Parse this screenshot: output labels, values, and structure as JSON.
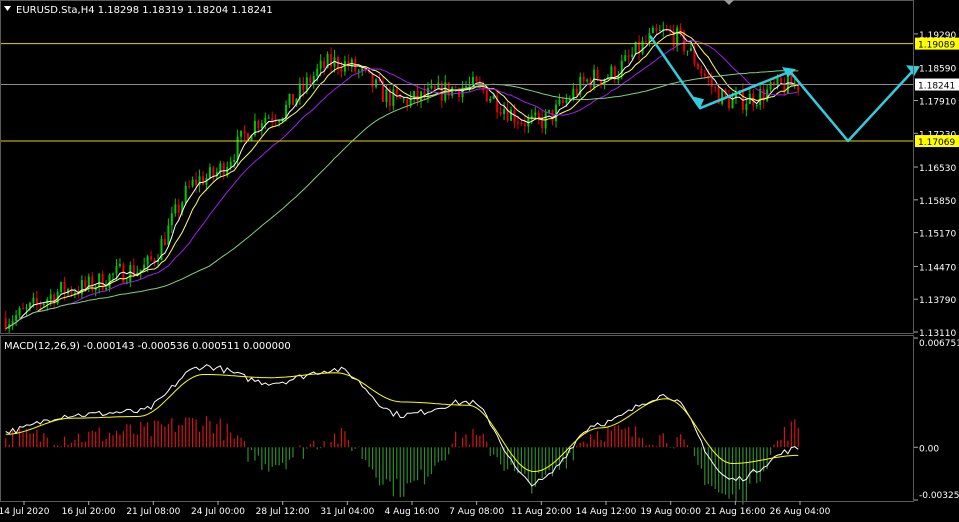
{
  "price_panel": {
    "header": "EURUSD.Sta,H4  1.18298 1.18319 1.18204 1.18241",
    "y_ticks": [
      "1.19290",
      "1.18590",
      "1.17910",
      "1.17230",
      "1.16530",
      "1.15850",
      "1.15170",
      "1.14470",
      "1.13790",
      "1.13110"
    ],
    "resistance_label": "1.19089",
    "current_label": "1.18241",
    "support_label": "1.17069"
  },
  "macd_panel": {
    "header": "MACD(12,26,9) -0.000143 -0.000536 0.000511 0.000000",
    "y_ticks": [
      "0.006751",
      "0.00",
      "-0.003256"
    ]
  },
  "x_ticks": [
    "14 Jul 2020",
    "16 Jul 20:00",
    "21 Jul 08:00",
    "24 Jul 00:00",
    "28 Jul 12:00",
    "31 Jul 04:00",
    "4 Aug 16:00",
    "7 Aug 08:00",
    "11 Aug 20:00",
    "14 Aug 12:00",
    "19 Aug 00:00",
    "21 Aug 16:00",
    "26 Aug 04:00"
  ],
  "colors": {
    "background": "#000000",
    "bull": "#00c800",
    "bear": "#e60000",
    "level_line": "#e6d200",
    "current_line": "#8c8c8c",
    "ma_white": "#ffffff",
    "ma_yellow": "#ffff66",
    "ma_purple": "#a020f0",
    "ma_green": "#7fd07f",
    "forecast": "#33ccdd",
    "macd_line": "#ffffff",
    "signal_line": "#ffff00",
    "hist_up": "#d21414",
    "hist_down": "#2e8b2e",
    "label_bg": "#ffff00",
    "text": "#ffffff"
  },
  "chart_data": {
    "type": "line",
    "symbol": "EURUSD.Sta",
    "timeframe": "H4",
    "price_ylim": [
      1.1311,
      1.1962
    ],
    "macd_ylim": [
      -0.003256,
      0.006751
    ],
    "levels": {
      "resistance": 1.19089,
      "current": 1.18241,
      "support": 1.17069
    },
    "ohlc_last": {
      "open": 1.18298,
      "high": 1.18319,
      "low": 1.18204,
      "close": 1.18241
    },
    "price_keypoints": [
      {
        "x": "14 Jul 2020",
        "y": 1.134
      },
      {
        "x": "16 Jul 20:00",
        "y": 1.14
      },
      {
        "x": "21 Jul 08:00",
        "y": 1.144
      },
      {
        "x": "24 Jul 00:00",
        "y": 1.163
      },
      {
        "x": "28 Jul 12:00",
        "y": 1.176
      },
      {
        "x": "31 Jul 04:00",
        "y": 1.187
      },
      {
        "x": "4 Aug 16:00",
        "y": 1.179
      },
      {
        "x": "7 Aug 08:00",
        "y": 1.182
      },
      {
        "x": "11 Aug 20:00",
        "y": 1.1745
      },
      {
        "x": "14 Aug 12:00",
        "y": 1.184
      },
      {
        "x": "19 Aug 00:00",
        "y": 1.193
      },
      {
        "x": "21 Aug 16:00",
        "y": 1.179
      },
      {
        "x": "26 Aug 04:00",
        "y": 1.1824
      }
    ],
    "macd_keypoints": [
      {
        "x": "14 Jul 2020",
        "macd": 0.001,
        "signal": 0.0008
      },
      {
        "x": "16 Jul 20:00",
        "macd": 0.002,
        "signal": 0.0018
      },
      {
        "x": "21 Jul 08:00",
        "macd": 0.0022,
        "signal": 0.0019
      },
      {
        "x": "24 Jul 00:00",
        "macd": 0.005,
        "signal": 0.0045
      },
      {
        "x": "28 Jul 12:00",
        "macd": 0.004,
        "signal": 0.0043
      },
      {
        "x": "31 Jul 04:00",
        "macd": 0.0048,
        "signal": 0.0046
      },
      {
        "x": "4 Aug 16:00",
        "macd": 0.002,
        "signal": 0.0028
      },
      {
        "x": "7 Aug 08:00",
        "macd": 0.0028,
        "signal": 0.0026
      },
      {
        "x": "11 Aug 20:00",
        "macd": -0.0022,
        "signal": -0.0015
      },
      {
        "x": "14 Aug 12:00",
        "macd": 0.0015,
        "signal": 0.0012
      },
      {
        "x": "19 Aug 00:00",
        "macd": 0.0032,
        "signal": 0.003
      },
      {
        "x": "21 Aug 16:00",
        "macd": -0.002,
        "signal": -0.001
      },
      {
        "x": "26 Aug 04:00",
        "macd": -0.0001,
        "signal": -0.0005
      }
    ]
  }
}
